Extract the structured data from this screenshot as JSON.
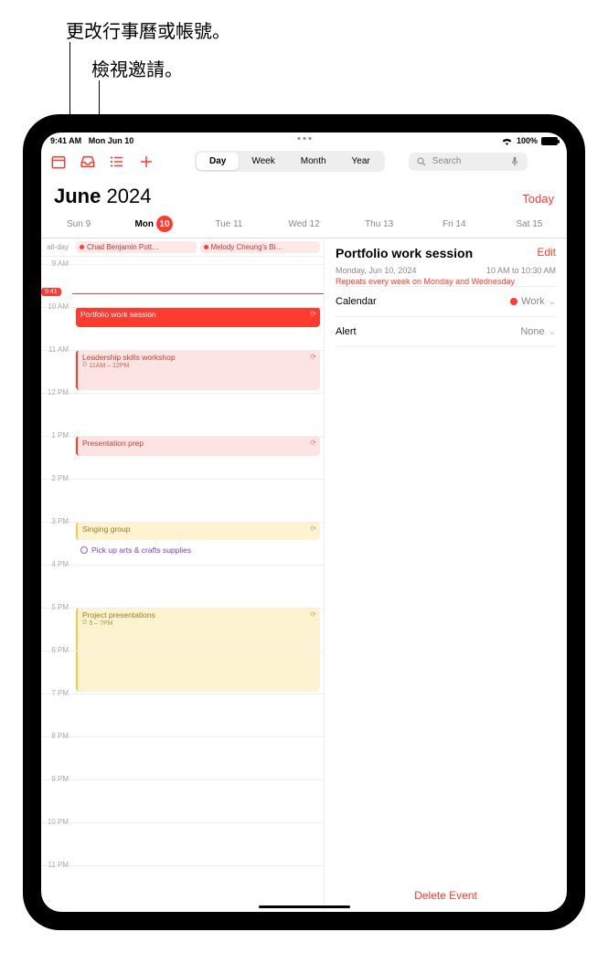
{
  "callouts": {
    "calendar_account": "更改行事曆或帳號。",
    "view_invites": "檢視邀請。"
  },
  "status": {
    "time": "9:41 AM",
    "date": "Mon Jun 10",
    "battery_pct": "100%"
  },
  "toolbar": {
    "view_segments": {
      "day": "Day",
      "week": "Week",
      "month": "Month",
      "year": "Year"
    },
    "search_placeholder": "Search"
  },
  "header": {
    "month": "June",
    "year": "2024",
    "today_label": "Today"
  },
  "weekdays": [
    {
      "label": "Sun",
      "num": "9",
      "selected": false
    },
    {
      "label": "Mon",
      "num": "10",
      "selected": true
    },
    {
      "label": "Tue",
      "num": "11",
      "selected": false
    },
    {
      "label": "Wed",
      "num": "12",
      "selected": false
    },
    {
      "label": "Thu",
      "num": "13",
      "selected": false
    },
    {
      "label": "Fri",
      "num": "14",
      "selected": false
    },
    {
      "label": "Sat",
      "num": "15",
      "selected": false
    }
  ],
  "allday": {
    "label": "all-day",
    "chips": [
      "Chad Benjamin Pott…",
      "Melody Cheung's Bi…"
    ]
  },
  "now": {
    "time": "9:41"
  },
  "hours": [
    "9 AM",
    "10 AM",
    "11 AM",
    "12 PM",
    "1 PM",
    "2 PM",
    "3 PM",
    "4 PM",
    "5 PM",
    "6 PM",
    "7 PM",
    "8 PM",
    "9 PM",
    "10 PM",
    "11 PM"
  ],
  "events": {
    "portfolio": {
      "title": "Portfolio work session"
    },
    "leadership": {
      "title": "Leadership skills workshop",
      "sub": "11AM – 12PM"
    },
    "presentation": {
      "title": "Presentation prep"
    },
    "singing": {
      "title": "Singing group"
    },
    "pickup": {
      "title": "Pick up arts & crafts supplies"
    },
    "project": {
      "title": "Project presentations",
      "sub": "5 – 7PM"
    }
  },
  "detail": {
    "title": "Portfolio work session",
    "edit": "Edit",
    "date_text": "Monday, Jun 10, 2024",
    "time_text": "10 AM to 10:30 AM",
    "repeat_text": "Repeats every week on Monday and Wednesday",
    "rows": {
      "calendar_label": "Calendar",
      "calendar_value": "Work",
      "alert_label": "Alert",
      "alert_value": "None"
    },
    "delete": "Delete Event"
  }
}
